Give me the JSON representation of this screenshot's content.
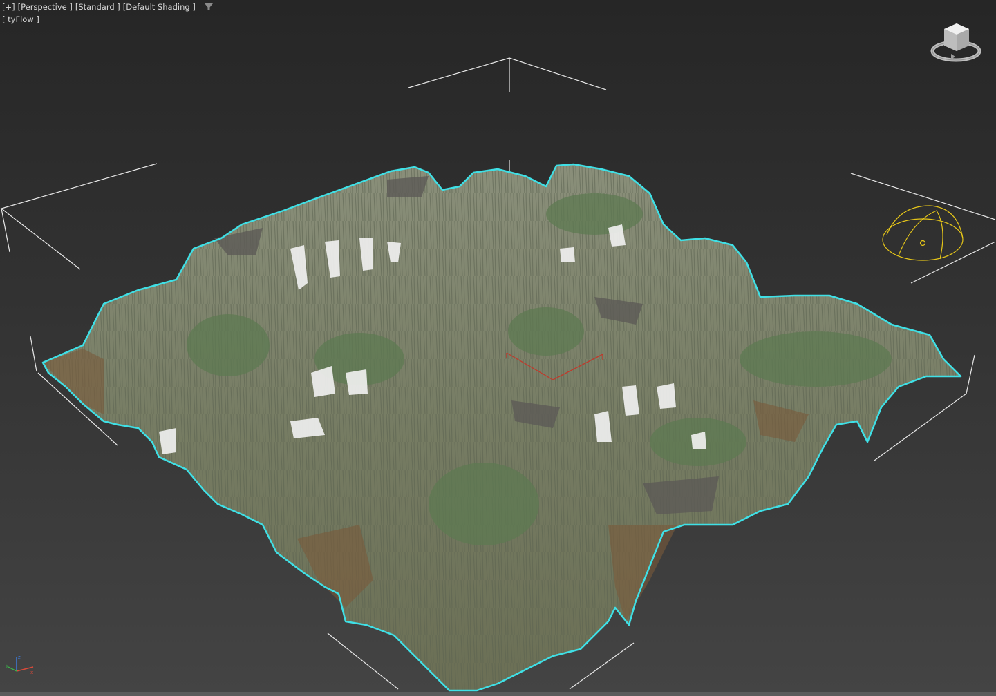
{
  "viewport": {
    "labels": {
      "plus": "[+]",
      "view": "[Perspective ]",
      "style": "[Standard ]",
      "shading": "[Default Shading ]",
      "plugin": "[ tyFlow ]"
    },
    "icons": {
      "filter": "filter-icon",
      "viewcube": "viewcube-icon",
      "axis": "axis-tripod-icon",
      "sun": "sun-helper-icon"
    },
    "colors": {
      "selection_outline": "#3fe0e6",
      "helper": "#e6c619",
      "gizmo": "#c0392b",
      "grid_lines": "#e8e8e8"
    }
  }
}
